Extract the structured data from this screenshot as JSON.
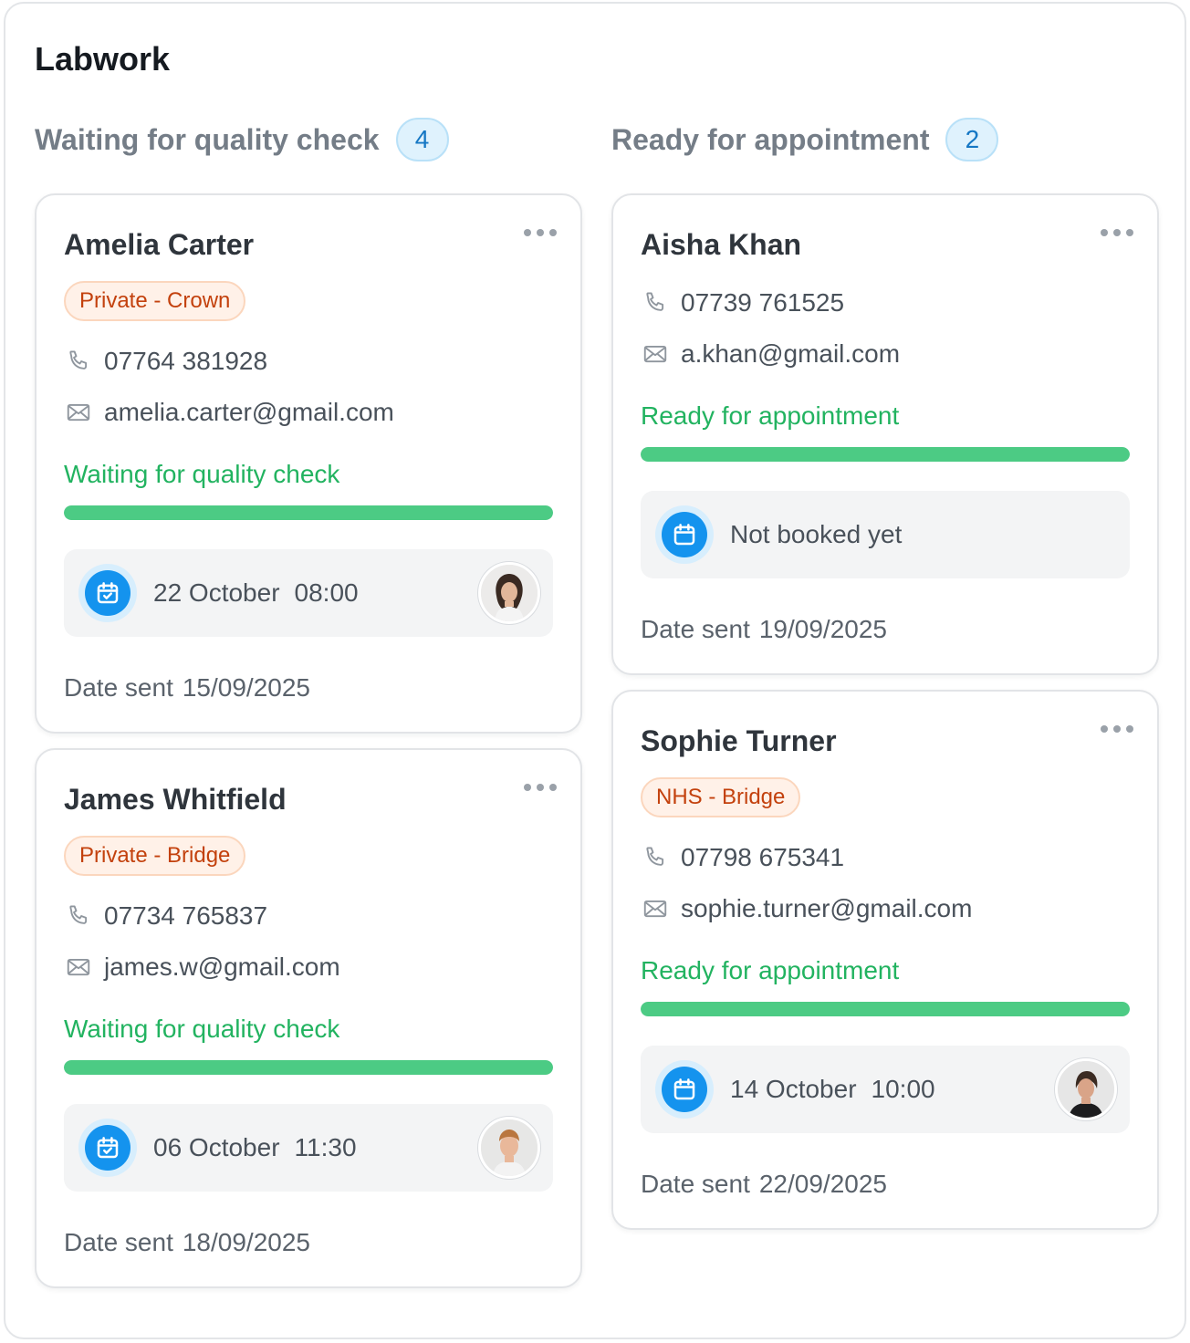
{
  "board": {
    "title": "Labwork"
  },
  "columns": [
    {
      "title": "Waiting for quality check",
      "count": "4",
      "cards": [
        {
          "name": "Amelia Carter",
          "tag": "Private - Crown",
          "phone": "07764 381928",
          "email": "amelia.carter@gmail.com",
          "status": "Waiting for quality check",
          "progress": 1.0,
          "appt_date": "22 October",
          "appt_time": "08:00",
          "date_sent_label": "Date sent",
          "date_sent": "15/09/2025"
        },
        {
          "name": "James Whitfield",
          "tag": "Private - Bridge",
          "phone": "07734 765837",
          "email": "james.w@gmail.com",
          "status": "Waiting for quality check",
          "progress": 1.0,
          "appt_date": "06 October",
          "appt_time": "11:30",
          "date_sent_label": "Date sent",
          "date_sent": "18/09/2025"
        }
      ]
    },
    {
      "title": "Ready for appointment",
      "count": "2",
      "cards": [
        {
          "name": "Aisha Khan",
          "phone": "07739 761525",
          "email": "a.khan@gmail.com",
          "status": "Ready for appointment",
          "progress": 1.0,
          "appt_text": "Not booked yet",
          "date_sent_label": "Date sent",
          "date_sent": "19/09/2025"
        },
        {
          "name": "Sophie Turner",
          "tag": "NHS - Bridge",
          "phone": "07798 675341",
          "email": "sophie.turner@gmail.com",
          "status": "Ready for appointment",
          "progress": 1.0,
          "appt_date": "14 October",
          "appt_time": "10:00",
          "date_sent_label": "Date sent",
          "date_sent": "22/09/2025"
        }
      ]
    }
  ],
  "colors": {
    "accent_blue": "#1493ee",
    "status_green": "#22b360",
    "progress_green": "#4ccb84",
    "tag_orange": "#c3410d"
  },
  "icons": [
    "phone-icon",
    "mail-icon",
    "calendar-check-icon",
    "calendar-icon",
    "more-icon"
  ]
}
